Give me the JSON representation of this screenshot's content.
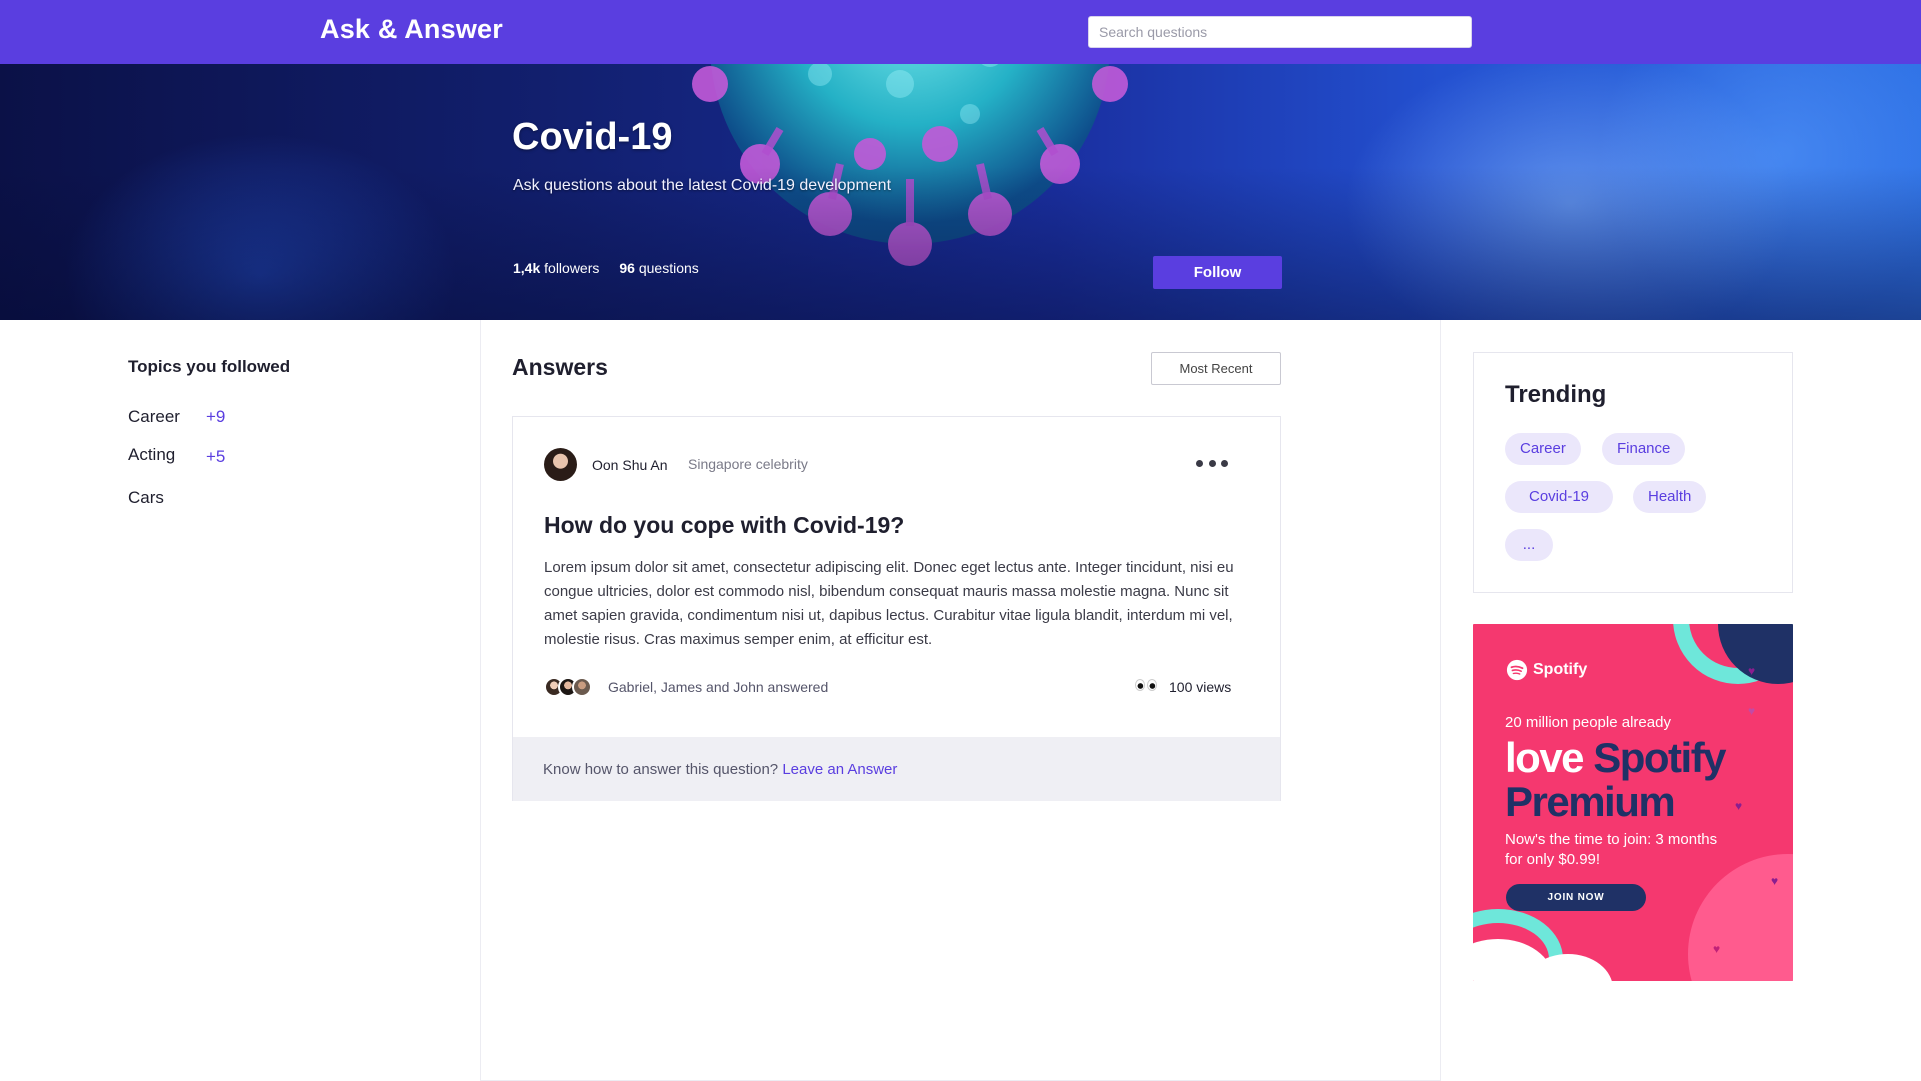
{
  "header": {
    "brand": "Ask & Answer",
    "search_placeholder": "Search questions"
  },
  "hero": {
    "title": "Covid-19",
    "subtitle": "Ask questions about the latest Covid-19 development",
    "followers_count": "1,4k",
    "followers_label": "followers",
    "questions_count": "96",
    "questions_label": "questions",
    "follow_label": "Follow"
  },
  "sidebar": {
    "title": "Topics you followed",
    "topics": [
      {
        "name": "Career",
        "count": "+9"
      },
      {
        "name": "Acting",
        "count": "+5"
      },
      {
        "name": "Cars",
        "count": ""
      }
    ]
  },
  "main": {
    "title": "Answers",
    "sort_label": "Most Recent",
    "card": {
      "author": "Oon Shu An",
      "author_role": "Singapore celebrity",
      "question": "How do you cope with Covid-19?",
      "body": "Lorem ipsum dolor sit amet, consectetur adipiscing elit. Donec eget lectus ante. Integer tincidunt, nisi eu congue ultricies, dolor est commodo nisl, bibendum consequat mauris massa molestie magna. Nunc sit amet sapien gravida, condimentum nisi ut, dapibus lectus. Curabitur vitae ligula blandit, interdum mi vel, molestie risus. Cras maximus semper enim, at efficitur est.",
      "answered_text": "Gabriel, James and John answered",
      "views": "100 views",
      "footer_prompt": "Know how to answer this question?",
      "footer_link": "Leave an Answer"
    }
  },
  "trending": {
    "title": "Trending",
    "tags": [
      "Career",
      "Finance",
      "Covid-19",
      "Health",
      "..."
    ]
  },
  "ad": {
    "brand": "Spotify",
    "line1": "20 million people already",
    "headline_a": "love",
    "headline_b": "Spotify",
    "headline_c": "Premium",
    "line2": "Now's the time to join: 3 months for only $0.99!",
    "cta": "JOIN NOW"
  },
  "colors": {
    "accent": "#5a3ee0",
    "chip_bg": "#ebe7fb",
    "ad_pink": "#f5386f",
    "ad_navy": "#1f3166"
  }
}
